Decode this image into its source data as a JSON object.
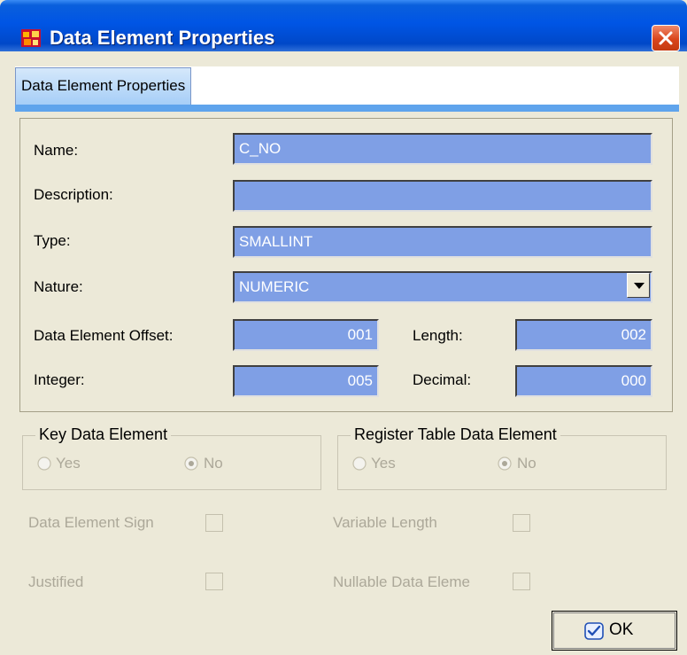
{
  "window": {
    "title": "Data Element Properties"
  },
  "tabs": [
    {
      "label": "Data Element Properties"
    }
  ],
  "form": {
    "name": {
      "label": "Name:",
      "value": "C_NO"
    },
    "description": {
      "label": "Description:",
      "value": ""
    },
    "type": {
      "label": "Type:",
      "value": "SMALLINT"
    },
    "nature": {
      "label": "Nature:",
      "value": "NUMERIC"
    },
    "offset": {
      "label": "Data Element Offset:",
      "value": "001"
    },
    "length": {
      "label": "Length:",
      "value": "002"
    },
    "integer": {
      "label": "Integer:",
      "value": "005"
    },
    "decimal": {
      "label": "Decimal:",
      "value": "000"
    }
  },
  "key_group": {
    "title": "Key Data Element",
    "yes": "Yes",
    "no": "No",
    "selected": "No"
  },
  "register_group": {
    "title": "Register Table Data Element",
    "yes": "Yes",
    "no": "No",
    "selected": "No"
  },
  "checkboxes": {
    "sign": "Data Element Sign",
    "variable_length": "Variable Length",
    "justified": "Justified",
    "nullable": "Nullable Data Eleme"
  },
  "ok_button": {
    "label": "OK"
  },
  "colors": {
    "field_bg": "#7f9fe5",
    "titlebar": "#0055e5",
    "dialog_bg": "#ece9d8"
  }
}
